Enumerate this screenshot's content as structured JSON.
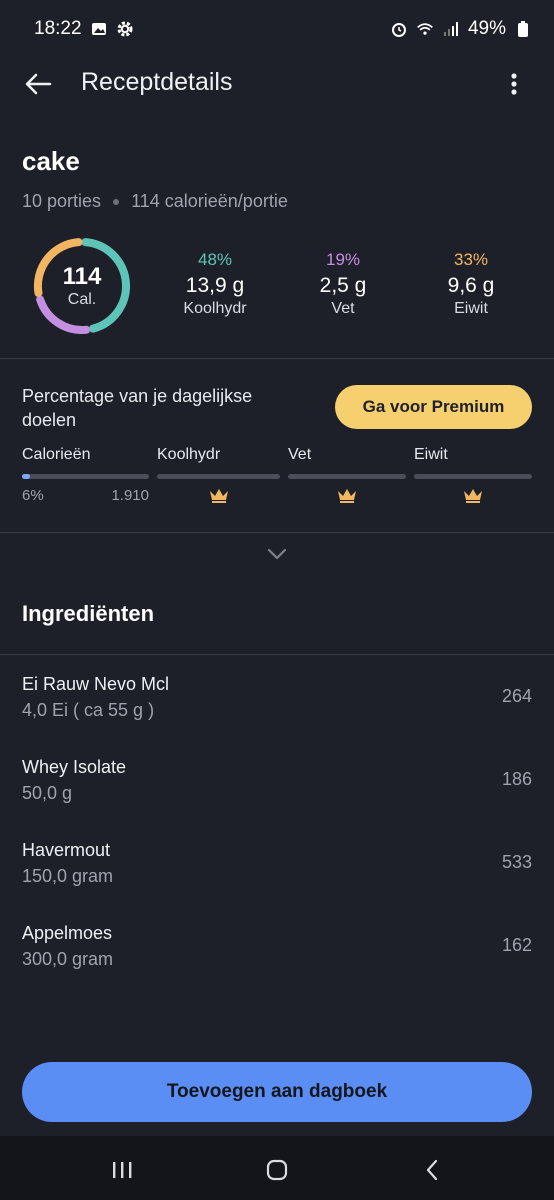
{
  "status_bar": {
    "time": "18:22",
    "battery": "49%"
  },
  "appbar": {
    "title": "Receptdetails"
  },
  "recipe": {
    "name": "cake",
    "portions": "10 porties",
    "calories_per_portion": "114 calorieën/portie"
  },
  "ring": {
    "value": "114",
    "unit": "Cal."
  },
  "macros": [
    {
      "pct": "48%",
      "value": "13,9 g",
      "label": "Koolhydr",
      "color": "#5fc4b8"
    },
    {
      "pct": "19%",
      "value": "2,5 g",
      "label": "Vet",
      "color": "#c48fe0"
    },
    {
      "pct": "33%",
      "value": "9,6 g",
      "label": "Eiwit",
      "color": "#f2b662"
    }
  ],
  "goals": {
    "title": "Percentage van je dagelijkse doelen",
    "premium_button": "Ga voor Premium",
    "columns": [
      {
        "label": "Calorieën",
        "percent": "6%",
        "goal": "1.910",
        "fill": 0.06
      },
      {
        "label": "Koolhydr",
        "locked": true
      },
      {
        "label": "Vet",
        "locked": true
      },
      {
        "label": "Eiwit",
        "locked": true
      }
    ]
  },
  "ingredients": {
    "title": "Ingrediënten",
    "items": [
      {
        "name": "Ei Rauw Nevo Mcl",
        "amount": "4,0 Ei ( ca 55 g )",
        "calories": "264"
      },
      {
        "name": "Whey Isolate",
        "amount": "50,0 g",
        "calories": "186"
      },
      {
        "name": "Havermout",
        "amount": "150,0 gram",
        "calories": "533"
      },
      {
        "name": "Appelmoes",
        "amount": "300,0 gram",
        "calories": "162"
      }
    ]
  },
  "add_button": "Toevoegen aan dagboek",
  "colors": {
    "accent": "#5b8ef5",
    "premium": "#f6cf6e",
    "background": "#1e2029"
  }
}
